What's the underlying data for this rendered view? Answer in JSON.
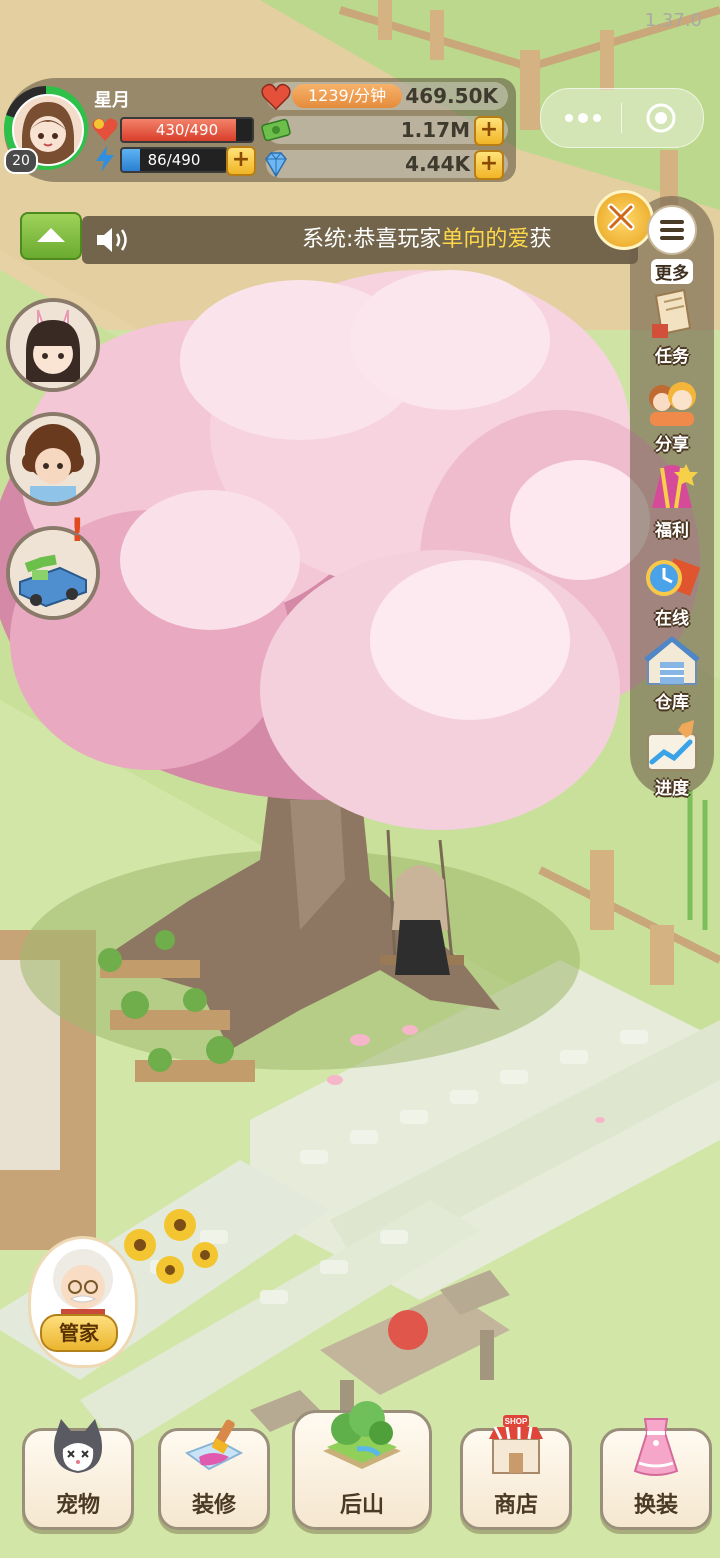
{
  "version": "1.37.0",
  "player": {
    "name": "星月",
    "level": "20",
    "hp_text": "430/490",
    "hp_fraction": 0.877,
    "energy_text": "86/490",
    "energy_fraction": 0.176
  },
  "resources": {
    "hearts_rate": "1239/分钟",
    "hearts": "469.50K",
    "cash": "1.17M",
    "diamonds": "4.44K",
    "plus": "+"
  },
  "announcement": {
    "prefix": "系统:恭喜玩家",
    "highlight": "单向的爱",
    "suffix": "获"
  },
  "side_menu": {
    "more": "更多",
    "items": [
      {
        "label": "任务",
        "icon": "scroll-icon"
      },
      {
        "label": "分享",
        "icon": "friends-icon"
      },
      {
        "label": "福利",
        "icon": "gift-icon"
      },
      {
        "label": "在线",
        "icon": "clock-gift-icon"
      },
      {
        "label": "仓库",
        "icon": "warehouse-icon"
      },
      {
        "label": "进度",
        "icon": "progress-chart-icon"
      }
    ]
  },
  "left_shortcuts": [
    {
      "icon": "bunny-girl-avatar-icon"
    },
    {
      "icon": "curly-hair-avatar-icon"
    },
    {
      "icon": "money-truck-icon",
      "alert": "!"
    }
  ],
  "butler": {
    "label": "管家"
  },
  "bottom_nav": [
    {
      "label": "宠物",
      "icon": "cat-icon"
    },
    {
      "label": "装修",
      "icon": "paint-brush-icon"
    },
    {
      "label": "后山",
      "icon": "hill-icon"
    },
    {
      "label": "商店",
      "icon": "shop-icon",
      "sign": "SHOP"
    },
    {
      "label": "换装",
      "icon": "dress-icon"
    }
  ],
  "colors": {
    "grass": "#cfe3a4",
    "blossom": "#f6c6d6",
    "accent_gold": "#f1b526",
    "hp_red": "#e4503a",
    "energy_blue": "#2f8fe0",
    "highlight_yellow": "#ffd84a"
  }
}
